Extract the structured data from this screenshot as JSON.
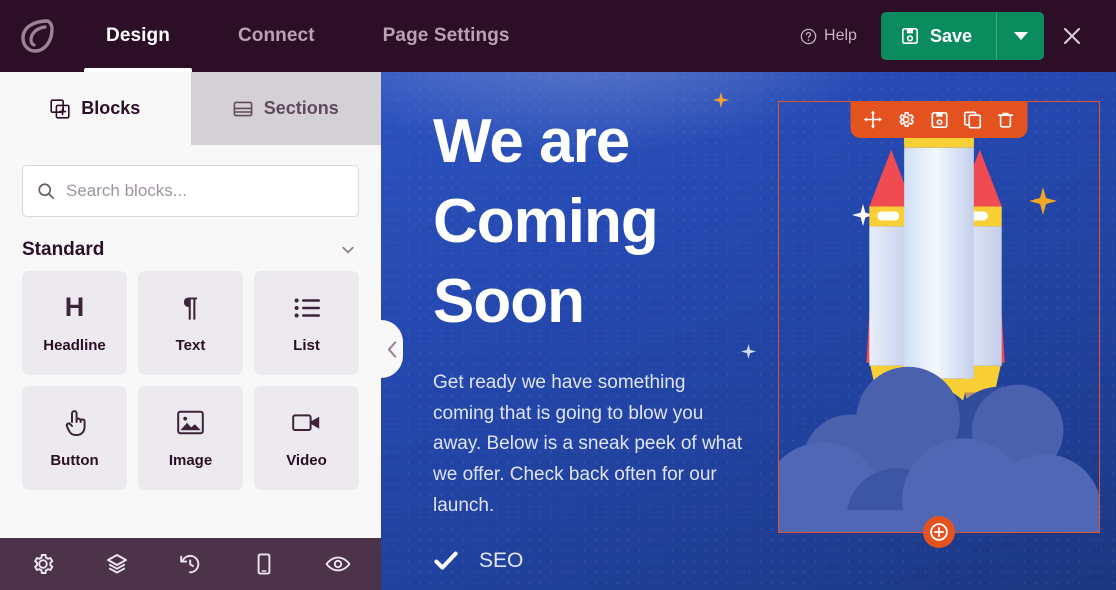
{
  "header": {
    "logo_name": "seedprod-leaf-logo",
    "tabs": [
      {
        "label": "Design",
        "active": true
      },
      {
        "label": "Connect",
        "active": false
      },
      {
        "label": "Page Settings",
        "active": false
      }
    ],
    "help_label": "Help",
    "save_label": "Save",
    "save_color": "#0b8c5f",
    "close_label": "×",
    "bg_color": "#2c0e27"
  },
  "sidebar": {
    "panel_tabs": [
      {
        "label": "Blocks",
        "icon": "blocks-icon",
        "active": true
      },
      {
        "label": "Sections",
        "icon": "sections-icon",
        "active": false
      }
    ],
    "search": {
      "placeholder": "Search blocks...",
      "value": "",
      "icon": "search-icon"
    },
    "group": {
      "title": "Standard",
      "collapsed": false
    },
    "blocks": [
      {
        "label": "Headline",
        "icon": "headline-icon"
      },
      {
        "label": "Text",
        "icon": "text-paragraph-icon"
      },
      {
        "label": "List",
        "icon": "list-icon"
      },
      {
        "label": "Button",
        "icon": "button-click-icon"
      },
      {
        "label": "Image",
        "icon": "image-icon"
      },
      {
        "label": "Video",
        "icon": "video-camera-icon"
      }
    ],
    "footer_icons": [
      "gear-icon",
      "layers-icon",
      "revision-history-icon",
      "mobile-device-icon",
      "eye-preview-icon"
    ],
    "bg_color": "#f8f8f9",
    "footer_bg_color": "#4c3349"
  },
  "canvas": {
    "background_color": "#2447ad",
    "collapse_handle_icon": "chevron-left-icon",
    "hero": {
      "title": "We are Coming Soon",
      "body": "Get ready we have something coming that is going to blow you away. Below is a sneak peek of what we offer. Check back often for our launch.",
      "feature": {
        "icon": "check-icon",
        "label": "SEO"
      }
    },
    "image_block": {
      "selected": true,
      "selection_color": "#e4521f",
      "toolbar_icons": [
        "move-icon",
        "gear-icon",
        "save-icon",
        "duplicate-icon",
        "trash-icon"
      ],
      "add_block_icon": "plus-circle-icon",
      "art_name": "rocket-launch-illustration"
    }
  }
}
